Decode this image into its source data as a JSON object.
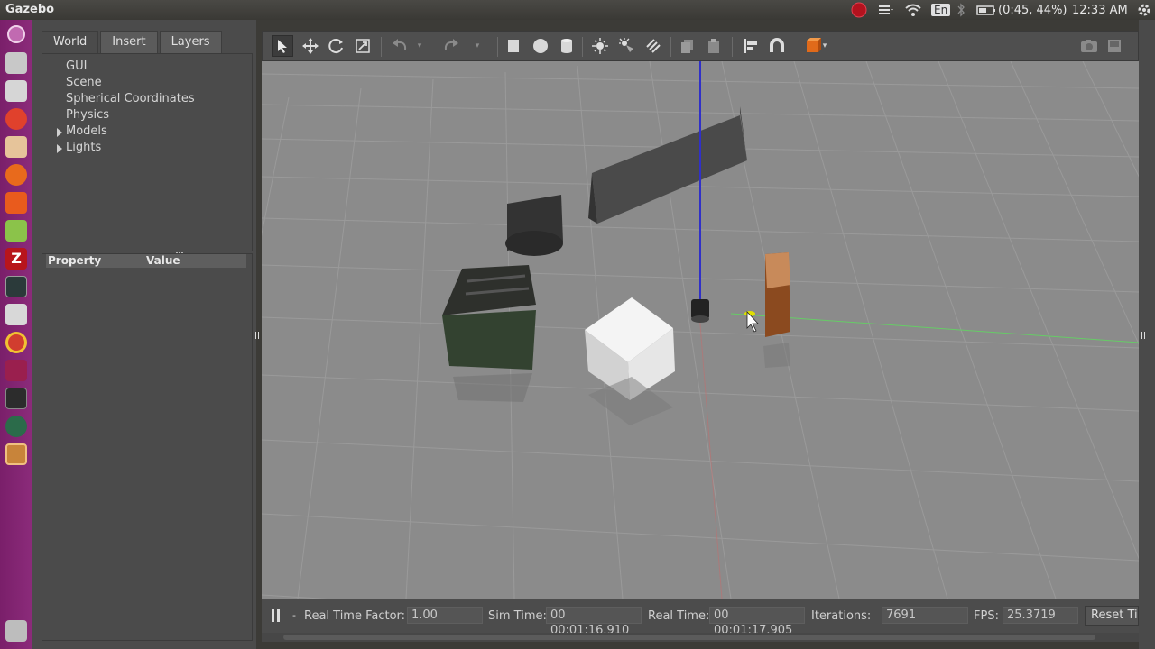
{
  "app": {
    "title": "Gazebo"
  },
  "tray": {
    "keyboard": "En",
    "battery": "(0:45, 44%)",
    "clock": "12:33 AM"
  },
  "left_panel": {
    "tabs": [
      "World",
      "Insert",
      "Layers"
    ],
    "tree": [
      "GUI",
      "Scene",
      "Spherical Coordinates",
      "Physics",
      "Models",
      "Lights"
    ],
    "property_header": {
      "property": "Property",
      "value": "Value"
    }
  },
  "statusbar": {
    "rtf_label": "Real Time Factor:",
    "rtf_value": "1.00",
    "sim_label": "Sim Time:",
    "sim_value": "00 00:01:16.910",
    "real_label": "Real Time:",
    "real_value": "00 00:01:17.905",
    "iter_label": "Iterations:",
    "iter_value": "7691",
    "fps_label": "FPS:",
    "fps_value": "25.3719",
    "reset_label": "Reset Ti"
  },
  "colors": {
    "launcher": "#8b2b7a",
    "viewport": "#8b8b8b",
    "panel": "#4b4b4b"
  }
}
